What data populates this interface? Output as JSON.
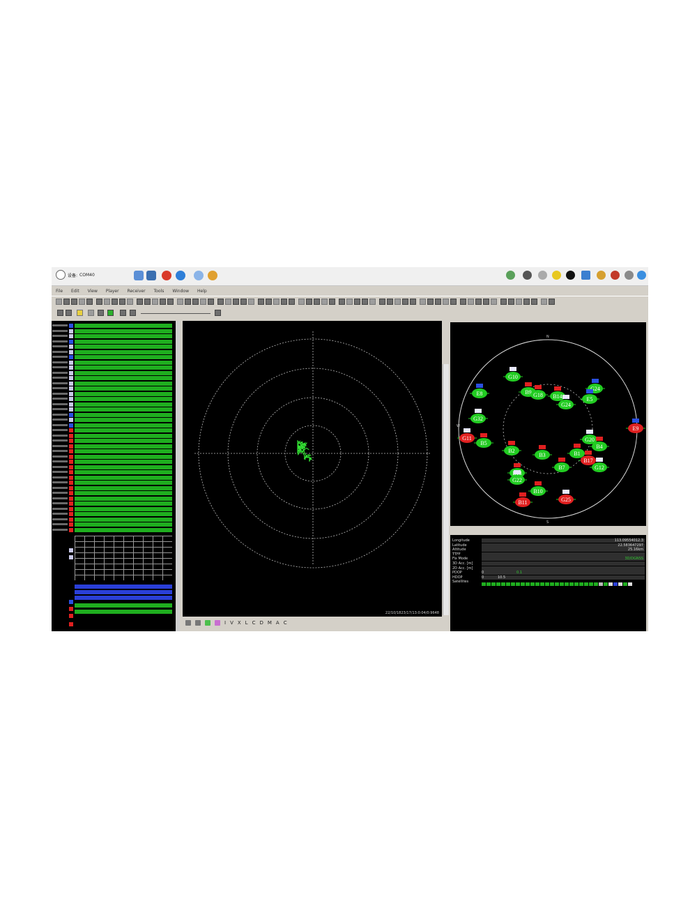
{
  "toolbar": {
    "device_label": "设备:",
    "port_value": "COM40"
  },
  "menu": [
    "File",
    "Edit",
    "View",
    "Player",
    "Receiver",
    "Tools",
    "Window",
    "Help"
  ],
  "center": {
    "tools": [
      "I",
      "V",
      "X",
      "L",
      "C",
      "D",
      "M",
      "A",
      "C"
    ],
    "timestamp": "22/10/1823/17/13:0:04/0:9648"
  },
  "sky": {
    "cardinal": {
      "n": "N",
      "s": "S",
      "w": "W"
    },
    "satellites": [
      {
        "id": "G10",
        "color": "green",
        "flag": "us"
      },
      {
        "id": "B9",
        "color": "green",
        "flag": "cn"
      },
      {
        "id": "G18",
        "color": "green",
        "flag": "cn"
      },
      {
        "id": "B14",
        "color": "green",
        "flag": "cn"
      },
      {
        "id": "G24",
        "color": "green",
        "flag": "eu"
      },
      {
        "id": "E8",
        "color": "green",
        "flag": "eu"
      },
      {
        "id": "G24",
        "color": "green",
        "flag": "us"
      },
      {
        "id": "E5",
        "color": "green",
        "flag": "eu"
      },
      {
        "id": "G32",
        "color": "green",
        "flag": "us"
      },
      {
        "id": "E9",
        "color": "red",
        "flag": "eu"
      },
      {
        "id": "G11",
        "color": "red",
        "flag": "us"
      },
      {
        "id": "B5",
        "color": "green",
        "flag": "cn"
      },
      {
        "id": "G20",
        "color": "green",
        "flag": "us"
      },
      {
        "id": "B4",
        "color": "green",
        "flag": "cn"
      },
      {
        "id": "B2",
        "color": "green",
        "flag": "cn"
      },
      {
        "id": "B3",
        "color": "green",
        "flag": "cn"
      },
      {
        "id": "B1",
        "color": "green",
        "flag": "cn"
      },
      {
        "id": "B17",
        "color": "red",
        "flag": "cn"
      },
      {
        "id": "G12",
        "color": "green",
        "flag": "us"
      },
      {
        "id": "B7",
        "color": "green",
        "flag": "cn"
      },
      {
        "id": "B13",
        "color": "green",
        "flag": "cn"
      },
      {
        "id": "G22",
        "color": "green",
        "flag": "us"
      },
      {
        "id": "B10",
        "color": "green",
        "flag": "cn"
      },
      {
        "id": "B11",
        "color": "red",
        "flag": "cn"
      },
      {
        "id": "G25",
        "color": "red",
        "flag": "us"
      }
    ]
  },
  "info": {
    "rows": [
      {
        "key": "Longitude",
        "value": "113.09554012.3",
        "color": "#dddddd"
      },
      {
        "key": "Latitude",
        "value": "22.583647297",
        "color": "#dddddd"
      },
      {
        "key": "Altitude",
        "value": "25.16km",
        "color": "#dddddd"
      },
      {
        "key": "TTFF",
        "value": "",
        "color": "#dddddd"
      },
      {
        "key": "Fix Mode",
        "value": "3D/DGNSS",
        "color": "#33cc33"
      },
      {
        "key": "3D Acc. [m]",
        "value": "",
        "color": "#dddddd"
      },
      {
        "key": "2D Acc. [m]",
        "value": "",
        "color": "#dddddd"
      },
      {
        "key": "PDOP",
        "value": "0.1",
        "color": "#dddddd"
      },
      {
        "key": "HDOP",
        "value": "0",
        "color": "#dddddd"
      },
      {
        "key": "Satellites",
        "value": "",
        "color": "#dddddd"
      }
    ],
    "pdop_left": "0",
    "pdop_mid": "0.1",
    "hdop_left": "0",
    "hdop_mid": "10.5"
  }
}
